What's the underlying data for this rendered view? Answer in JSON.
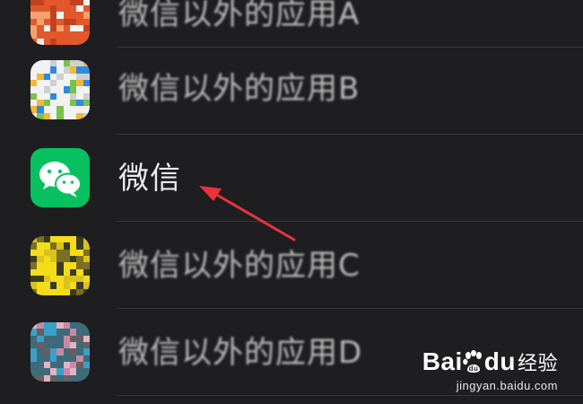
{
  "apps": [
    {
      "name": "微信以外的应用A",
      "icon": "app-icon-a",
      "blurred": true,
      "colors": [
        "#e3572b",
        "#f3f3f3",
        "#c24220",
        "#f7a26e"
      ]
    },
    {
      "name": "微信以外的应用B",
      "icon": "app-icon-b",
      "blurred": true,
      "colors": [
        "#f2f2f2",
        "#2f89e0",
        "#79c14a",
        "#f2b830",
        "#cfcfcf"
      ]
    },
    {
      "name": "微信",
      "icon": "wechat-icon",
      "blurred": false,
      "colors": [
        "#07c160",
        "#ffffff"
      ]
    },
    {
      "name": "微信以外的应用C",
      "icon": "app-icon-c",
      "blurred": true,
      "colors": [
        "#f4dc19",
        "#3b3b20",
        "#d9c21c",
        "#7a6f25"
      ]
    },
    {
      "name": "微信以外的应用D",
      "icon": "app-icon-d",
      "blurred": true,
      "colors": [
        "#3f6a7a",
        "#c68aa6",
        "#3aa0c9",
        "#6a5e5e",
        "#e0b3c5"
      ]
    }
  ],
  "annotation": {
    "color": "#e8333a",
    "target": "微信"
  },
  "watermark": {
    "brand_left": "Bai",
    "brand_right": "du",
    "brand_cn": "经验",
    "url": "jingyan.baidu.com"
  }
}
